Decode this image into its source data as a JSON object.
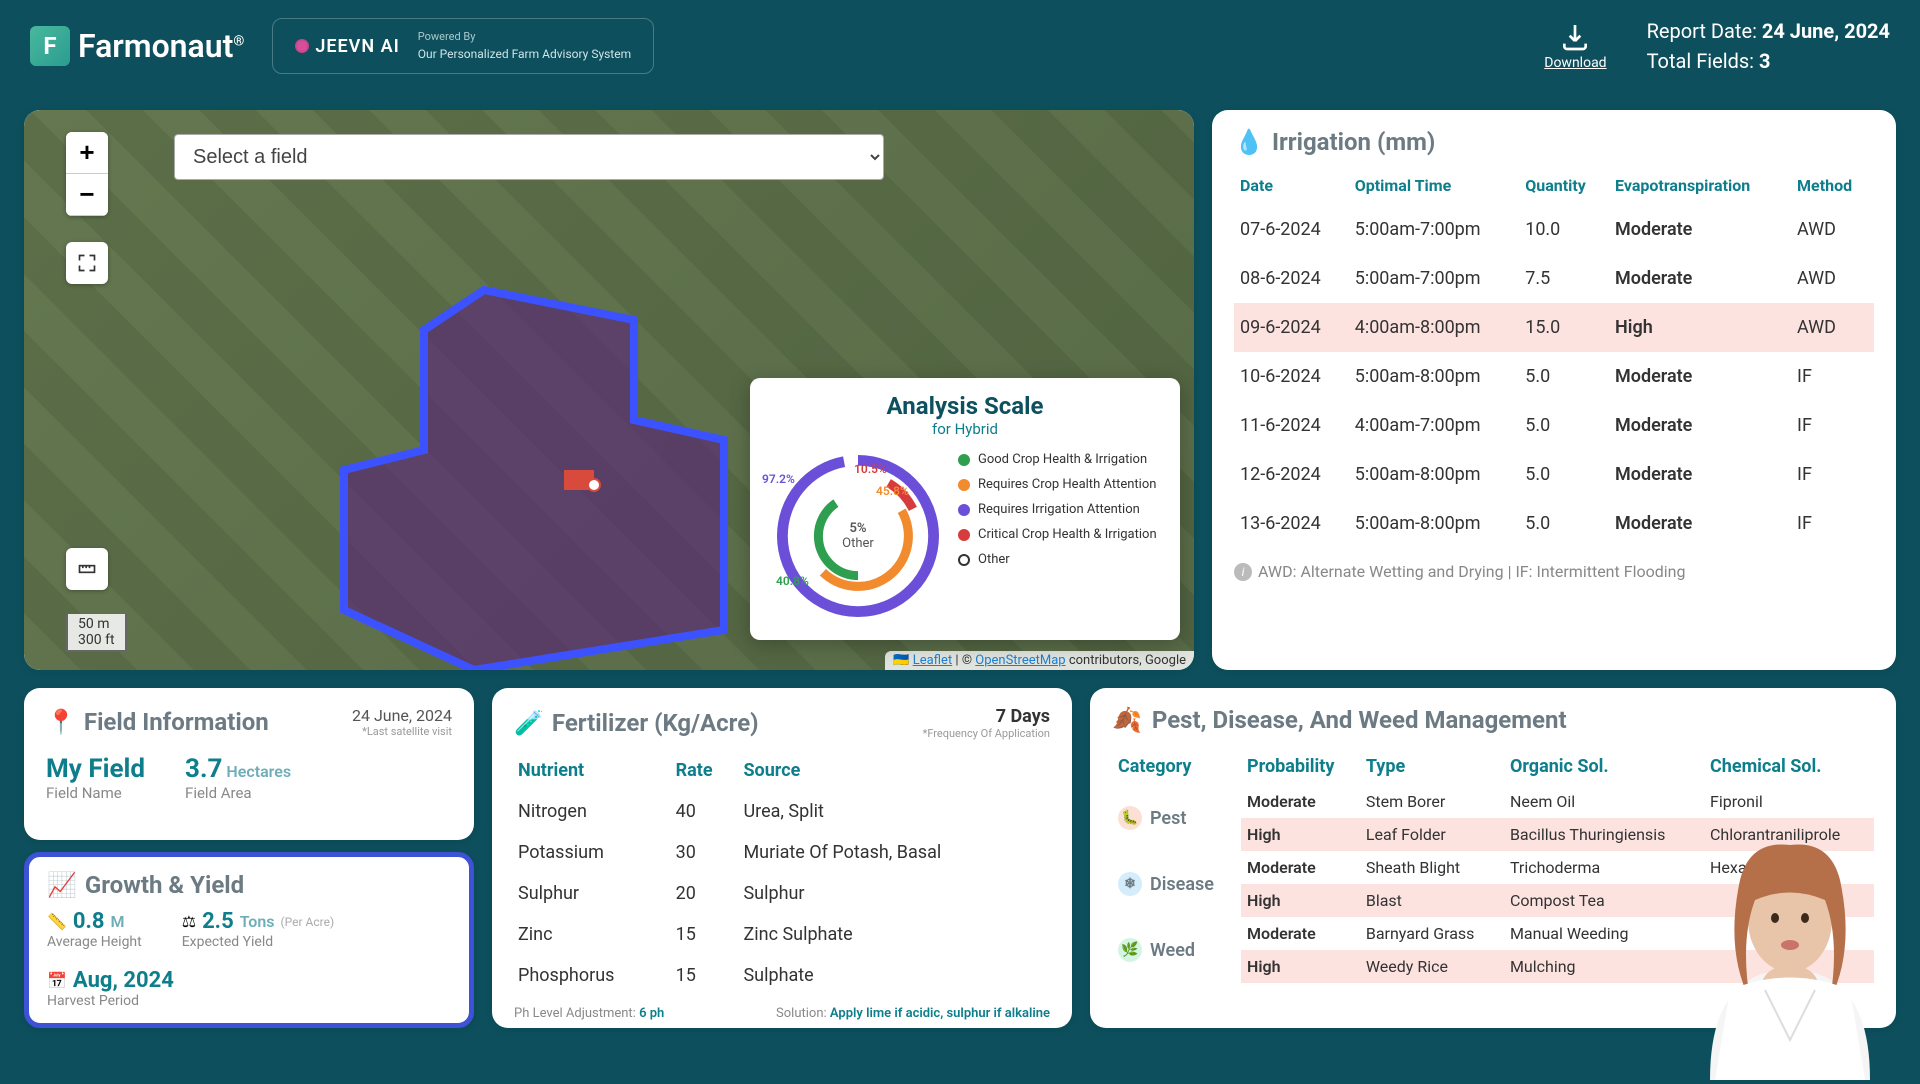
{
  "header": {
    "brand": "Farmonaut",
    "brand_reg": "®",
    "jeevn_label": "jeevN Ai",
    "powered_by_label": "Powered By",
    "powered_by_text": "Our Personalized Farm Advisory System",
    "download_label": "Download",
    "report_date_label": "Report Date:",
    "report_date": "24 June, 2024",
    "total_fields_label": "Total Fields:",
    "total_fields": "3"
  },
  "map": {
    "select_placeholder": "Select a field",
    "scale_m": "50 m",
    "scale_ft": "300 ft",
    "attrib_leaflet": "Leaflet",
    "attrib_osm": "OpenStreetMap",
    "attrib_rest": " contributors, Google",
    "analysis": {
      "title": "Analysis Scale",
      "subtitle": "for Hybrid",
      "center_val": "5%",
      "center_lbl": "Other",
      "labels": {
        "purple": "97.2%",
        "orange": "10.5%",
        "darkorange": "45.8%",
        "green": "40.8%"
      },
      "legend": [
        {
          "color": "#2e9e4f",
          "text": "Good Crop Health & Irrigation"
        },
        {
          "color": "#f28a2e",
          "text": "Requires Crop Health Attention"
        },
        {
          "color": "#6b4fd8",
          "text": "Requires Irrigation Attention"
        },
        {
          "color": "#d63c3c",
          "text": "Critical Crop Health & Irrigation"
        },
        {
          "color": "#ffffff",
          "text": "Other",
          "border": true
        }
      ]
    }
  },
  "irrigation": {
    "title": "Irrigation (mm)",
    "headers": {
      "date": "Date",
      "time": "Optimal Time",
      "qty": "Quantity",
      "et": "Evapotranspiration",
      "method": "Method"
    },
    "rows": [
      {
        "date": "07-6-2024",
        "time": "5:00am-7:00pm",
        "qty": "10.0",
        "et": "Moderate",
        "method": "AWD"
      },
      {
        "date": "08-6-2024",
        "time": "5:00am-7:00pm",
        "qty": "7.5",
        "et": "Moderate",
        "method": "AWD"
      },
      {
        "date": "09-6-2024",
        "time": "4:00am-8:00pm",
        "qty": "15.0",
        "et": "High",
        "method": "AWD",
        "high": true
      },
      {
        "date": "10-6-2024",
        "time": "5:00am-8:00pm",
        "qty": "5.0",
        "et": "Moderate",
        "method": "IF"
      },
      {
        "date": "11-6-2024",
        "time": "4:00am-7:00pm",
        "qty": "5.0",
        "et": "Moderate",
        "method": "IF"
      },
      {
        "date": "12-6-2024",
        "time": "5:00am-8:00pm",
        "qty": "5.0",
        "et": "Moderate",
        "method": "IF"
      },
      {
        "date": "13-6-2024",
        "time": "5:00am-8:00pm",
        "qty": "5.0",
        "et": "Moderate",
        "method": "IF"
      }
    ],
    "footer": "AWD: Alternate Wetting and Drying | IF: Intermittent Flooding"
  },
  "field_info": {
    "title": "Field Information",
    "date": "24 June, 2024",
    "date_note": "*Last satellite visit",
    "name_val": "My Field",
    "name_lbl": "Field Name",
    "area_val": "3.7",
    "area_unit": "Hectares",
    "area_lbl": "Field Area"
  },
  "growth": {
    "title": "Growth & Yield",
    "height_val": "0.8",
    "height_unit": "M",
    "height_lbl": "Average Height",
    "yield_val": "2.5",
    "yield_unit": "Tons",
    "yield_per": "(Per Acre)",
    "yield_lbl": "Expected Yield",
    "harvest_val": "Aug, 2024",
    "harvest_lbl": "Harvest Period"
  },
  "fertilizer": {
    "title": "Fertilizer (Kg/Acre)",
    "freq_val": "7 Days",
    "freq_lbl": "*Frequency Of Application",
    "headers": {
      "nutrient": "Nutrient",
      "rate": "Rate",
      "source": "Source"
    },
    "rows": [
      {
        "n": "Nitrogen",
        "r": "40",
        "s": "Urea, Split"
      },
      {
        "n": "Potassium",
        "r": "30",
        "s": "Muriate Of Potash, Basal"
      },
      {
        "n": "Sulphur",
        "r": "20",
        "s": "Sulphur"
      },
      {
        "n": "Zinc",
        "r": "15",
        "s": "Zinc Sulphate"
      },
      {
        "n": "Phosphorus",
        "r": "15",
        "s": "Sulphate"
      }
    ],
    "ph_lbl": "Ph Level Adjustment:",
    "ph_val": "6 ph",
    "sol_lbl": "Solution:",
    "sol_val": "Apply lime if acidic, sulphur if alkaline"
  },
  "pest": {
    "title": "Pest, Disease, And Weed Management",
    "headers": {
      "cat": "Category",
      "prob": "Probability",
      "type": "Type",
      "org": "Organic Sol.",
      "chem": "Chemical Sol."
    },
    "groups": [
      {
        "cat": "Pest",
        "icon": "🐛",
        "bg": "#fde0d5",
        "rows": [
          {
            "prob": "Moderate",
            "type": "Stem Borer",
            "org": "Neem Oil",
            "chem": "Fipronil"
          },
          {
            "prob": "High",
            "type": "Leaf Folder",
            "org": "Bacillus Thuringiensis",
            "chem": "Chlorantraniliprole",
            "high": true
          }
        ]
      },
      {
        "cat": "Disease",
        "icon": "❄",
        "bg": "#d5ecfa",
        "rows": [
          {
            "prob": "Moderate",
            "type": "Sheath Blight",
            "org": "Trichoderma",
            "chem": "Hexaconazole"
          },
          {
            "prob": "High",
            "type": "Blast",
            "org": "Compost Tea",
            "chem": "",
            "high": true
          }
        ]
      },
      {
        "cat": "Weed",
        "icon": "🌿",
        "bg": "#d5f5e3",
        "rows": [
          {
            "prob": "Moderate",
            "type": "Barnyard Grass",
            "org": "Manual Weeding",
            "chem": ""
          },
          {
            "prob": "High",
            "type": "Weedy Rice",
            "org": "Mulching",
            "chem": "",
            "high": true
          }
        ]
      }
    ]
  }
}
